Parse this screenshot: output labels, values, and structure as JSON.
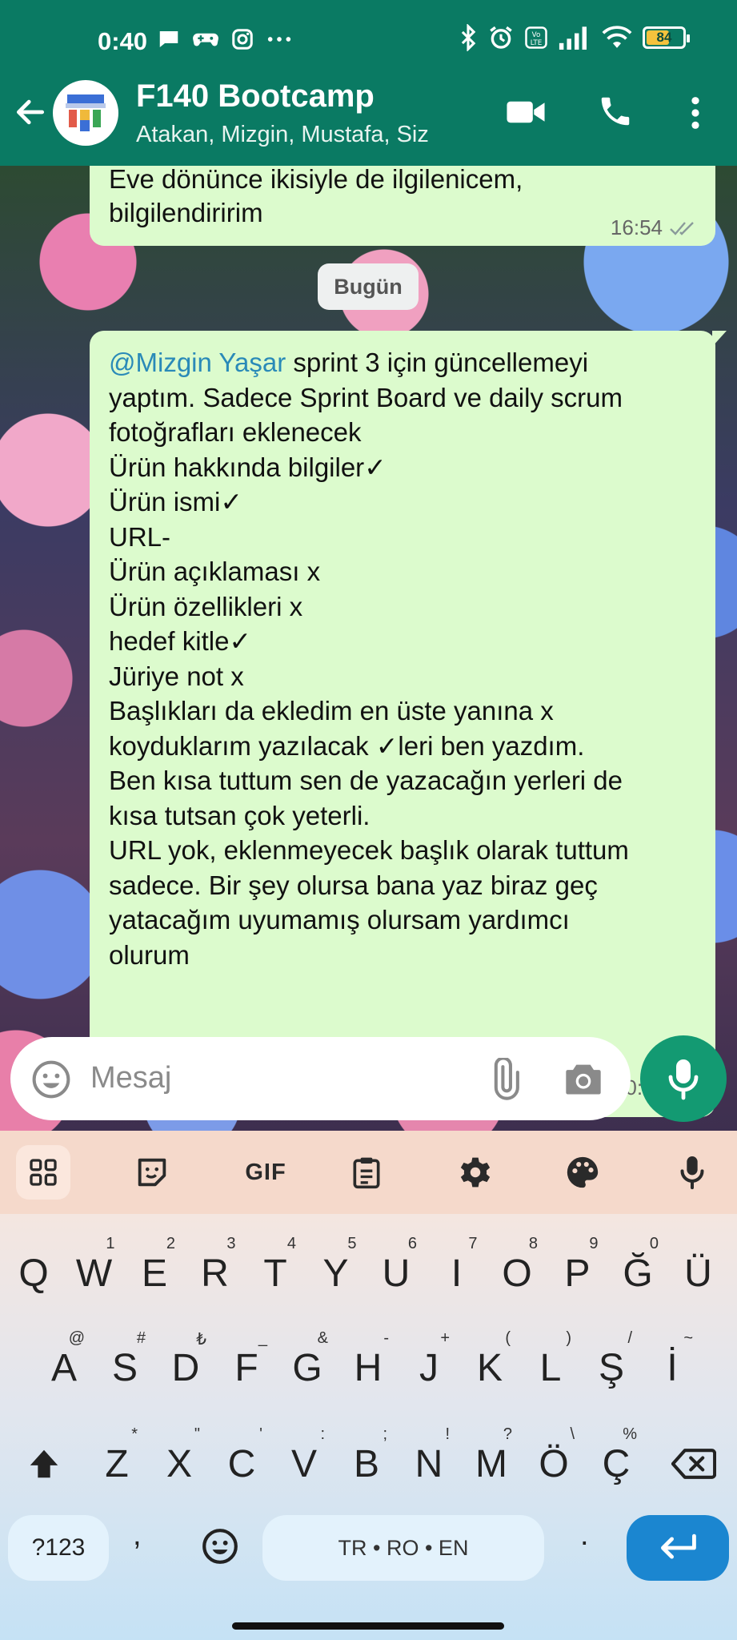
{
  "status": {
    "time": "0:40",
    "battery": "84",
    "network": "VoLTE"
  },
  "header": {
    "title": "F140 Bootcamp",
    "members": "Atakan, Mizgin, Mustafa, Siz"
  },
  "messages": [
    {
      "text_lines": [
        "Eve dönünce ikisiyle de ilgilenicem,",
        "bilgilendiririm"
      ],
      "time": "16:54",
      "ticks": "double-read"
    },
    {
      "mention": "@Mizgin Yaşar",
      "first_line_rest": " sprint 3 için güncellemeyi",
      "text_lines": [
        "yaptım. Sadece Sprint Board ve daily scrum",
        "fotoğrafları eklenecek",
        "Ürün hakkında bilgiler✓",
        "Ürün ismi✓",
        "URL-",
        "Ürün açıklaması x",
        "Ürün özellikleri x",
        "hedef kitle✓",
        "Jüriye not x",
        "Başlıkları da ekledim en üste yanına x",
        "koyduklarım yazılacak ✓leri ben yazdım.",
        "Ben kısa tuttum sen de yazacağın yerleri de",
        "kısa tutsan çok yeterli.",
        "URL yok, eklenmeyecek başlık olarak tuttum",
        "sadece. Bir şey olursa bana yaz biraz geç",
        "yatacağım uyumamış olursam yardımcı",
        "olurum"
      ],
      "time": "00:40",
      "ticks": "single-sent"
    }
  ],
  "day_divider": "Bugün",
  "composer": {
    "placeholder": "Mesaj"
  },
  "keyboard": {
    "toolbar": [
      "apps-icon",
      "sticker-icon",
      "GIF",
      "clipboard-icon",
      "settings-icon",
      "palette-icon",
      "mic-icon"
    ],
    "gif_label": "GIF",
    "row1": [
      [
        "Q",
        ""
      ],
      [
        "W",
        "1"
      ],
      [
        "E",
        "2"
      ],
      [
        "R",
        "3"
      ],
      [
        "T",
        "4"
      ],
      [
        "Y",
        "5"
      ],
      [
        "U",
        "6"
      ],
      [
        "I",
        "7"
      ],
      [
        "O",
        "8"
      ],
      [
        "P",
        "9"
      ],
      [
        "Ğ",
        "0"
      ],
      [
        "Ü",
        ""
      ]
    ],
    "row2": [
      [
        "A",
        "@"
      ],
      [
        "S",
        "#"
      ],
      [
        "D",
        "₺"
      ],
      [
        "F",
        "_"
      ],
      [
        "G",
        "&"
      ],
      [
        "H",
        "-"
      ],
      [
        "J",
        "+"
      ],
      [
        "K",
        "("
      ],
      [
        "L",
        ")"
      ],
      [
        "Ş",
        "/"
      ],
      [
        "İ",
        "~"
      ]
    ],
    "row3": [
      [
        "Z",
        "*"
      ],
      [
        "X",
        "\""
      ],
      [
        "C",
        "'"
      ],
      [
        "V",
        ":"
      ],
      [
        "B",
        ";"
      ],
      [
        "N",
        "!"
      ],
      [
        "M",
        "?"
      ],
      [
        "Ö",
        "\\"
      ],
      [
        "Ç",
        "%"
      ]
    ],
    "sym_label": "?123",
    "comma": ",",
    "space_label": "TR • RO • EN",
    "period": "."
  }
}
